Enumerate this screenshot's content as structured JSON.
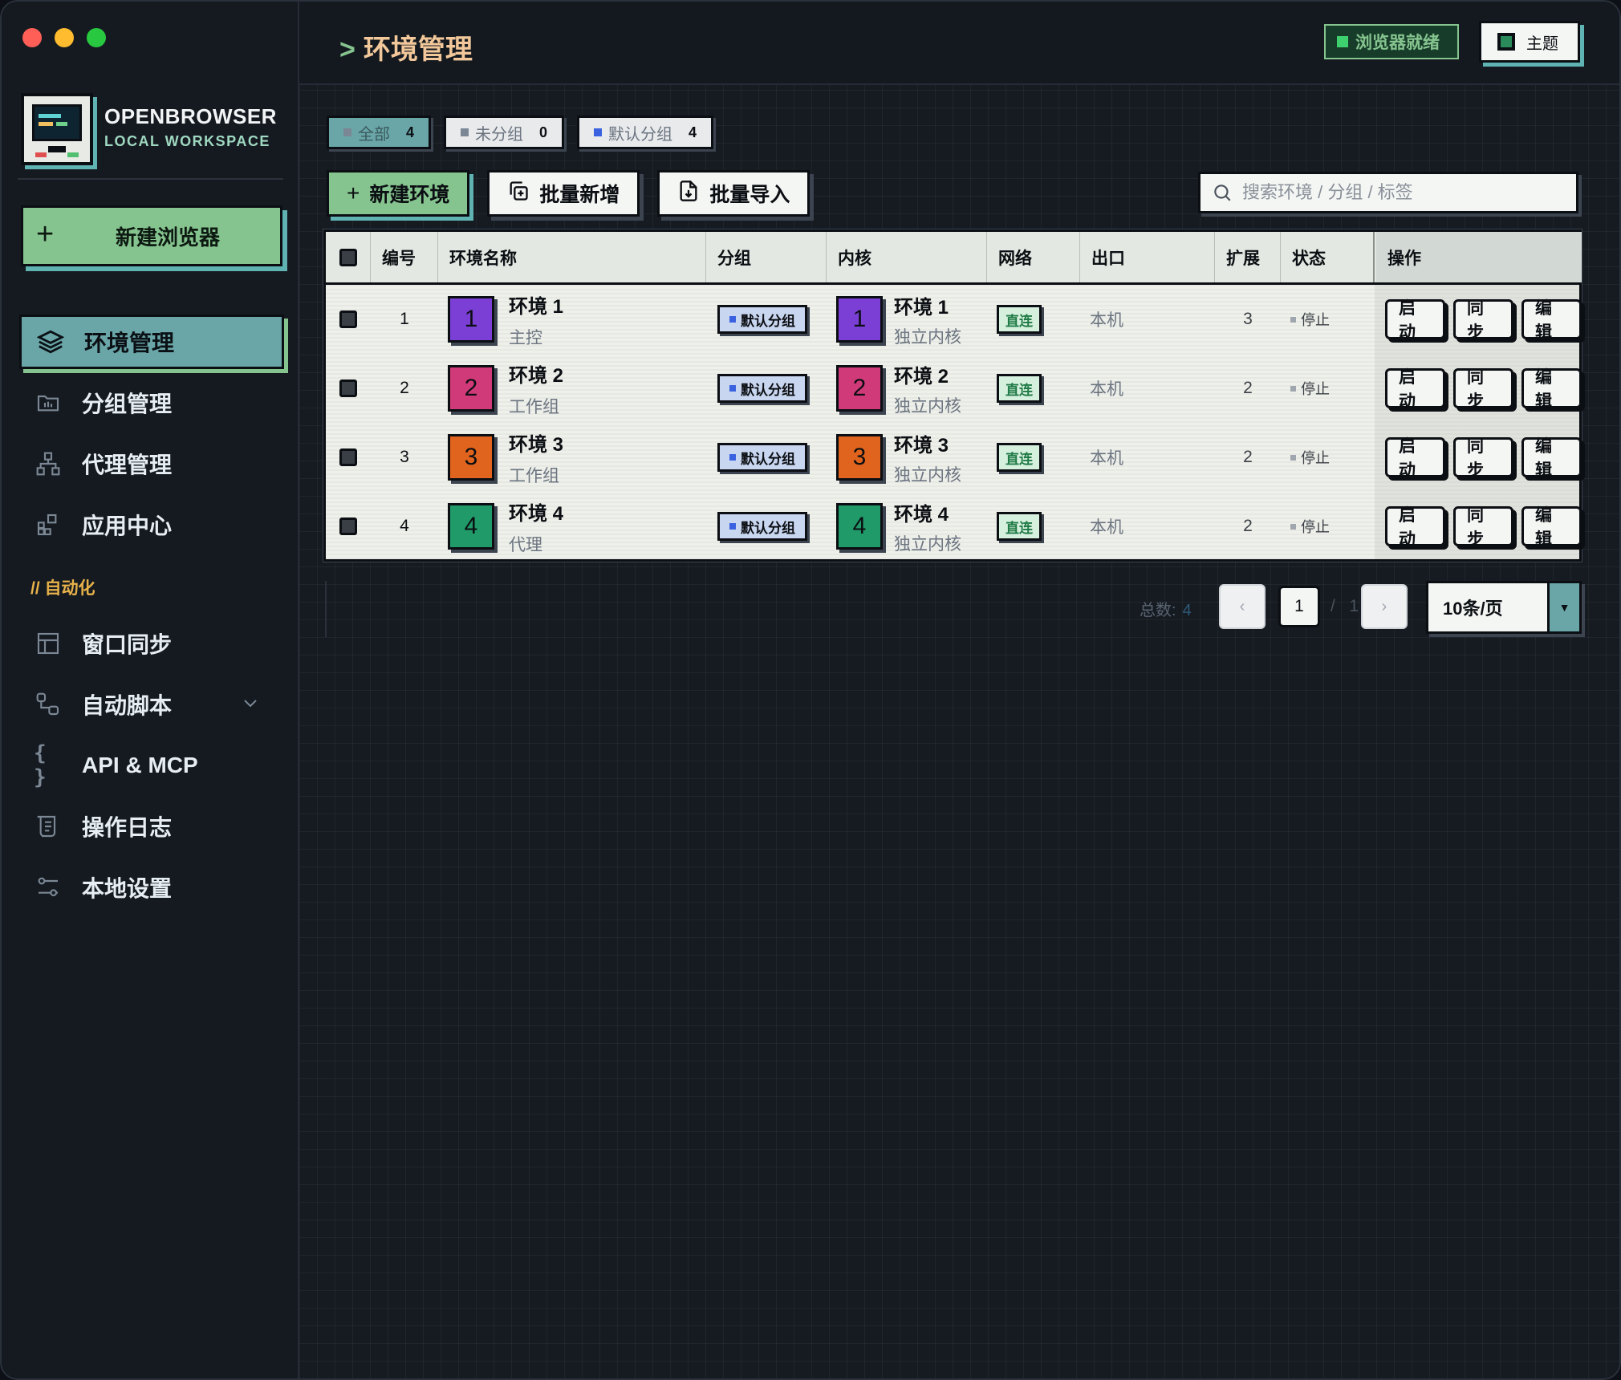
{
  "window": {
    "controls": [
      "close",
      "minimize",
      "zoom"
    ]
  },
  "brand": {
    "name": "OPENBROWSER",
    "subtitle": "LOCAL WORKSPACE"
  },
  "sidebar": {
    "new_browser_label": "新建浏览器",
    "items": [
      {
        "label": "环境管理",
        "icon": "layers-icon",
        "active": true
      },
      {
        "label": "分组管理",
        "icon": "folder-icon"
      },
      {
        "label": "代理管理",
        "icon": "network-icon"
      },
      {
        "label": "应用中心",
        "icon": "apps-icon"
      }
    ],
    "section_label": "// 自动化",
    "automation_items": [
      {
        "label": "窗口同步",
        "icon": "window-icon"
      },
      {
        "label": "自动脚本",
        "icon": "flow-icon",
        "has_submenu": true
      },
      {
        "label": "API & MCP",
        "icon": "braces-icon"
      },
      {
        "label": "操作日志",
        "icon": "log-icon"
      },
      {
        "label": "本地设置",
        "icon": "sliders-icon"
      }
    ]
  },
  "header": {
    "prompt": ">",
    "title": "环境管理",
    "status_label": "浏览器就绪",
    "theme_label": "主题"
  },
  "filters": [
    {
      "label": "全部",
      "count": "4",
      "active": true
    },
    {
      "label": "未分组",
      "count": "0"
    },
    {
      "label": "默认分组",
      "count": "4",
      "dot": "blue"
    }
  ],
  "toolbar": {
    "new_env_label": "新建环境",
    "batch_add_label": "批量新增",
    "batch_import_label": "批量导入"
  },
  "search": {
    "placeholder": "搜索环境 / 分组 / 标签",
    "value": ""
  },
  "table": {
    "columns": [
      "编号",
      "环境名称",
      "分组",
      "内核",
      "网络",
      "出口",
      "扩展",
      "状态",
      "操作"
    ],
    "rows": [
      {
        "id": "1",
        "name": "环境 1",
        "role": "主控",
        "group": "默认分组",
        "kernel_name": "环境 1",
        "kernel_sub": "独立内核",
        "network": "直连",
        "exit": "本机",
        "ext": "3",
        "state": "停止",
        "color": "#7b3fd6"
      },
      {
        "id": "2",
        "name": "环境 2",
        "role": "工作组",
        "group": "默认分组",
        "kernel_name": "环境 2",
        "kernel_sub": "独立内核",
        "network": "直连",
        "exit": "本机",
        "ext": "2",
        "state": "停止",
        "color": "#d03a78"
      },
      {
        "id": "3",
        "name": "环境 3",
        "role": "工作组",
        "group": "默认分组",
        "kernel_name": "环境 3",
        "kernel_sub": "独立内核",
        "network": "直连",
        "exit": "本机",
        "ext": "2",
        "state": "停止",
        "color": "#e0641e"
      },
      {
        "id": "4",
        "name": "环境 4",
        "role": "代理",
        "group": "默认分组",
        "kernel_name": "环境 4",
        "kernel_sub": "独立内核",
        "network": "直连",
        "exit": "本机",
        "ext": "2",
        "state": "停止",
        "color": "#1f9a68"
      }
    ],
    "actions": [
      "启动",
      "同步",
      "编辑"
    ]
  },
  "pagination": {
    "total_label": "总数:",
    "total": "4",
    "prev": "‹",
    "next": "›",
    "current": "1",
    "separator": "/",
    "pages": "1",
    "page_size": "10条/页"
  }
}
